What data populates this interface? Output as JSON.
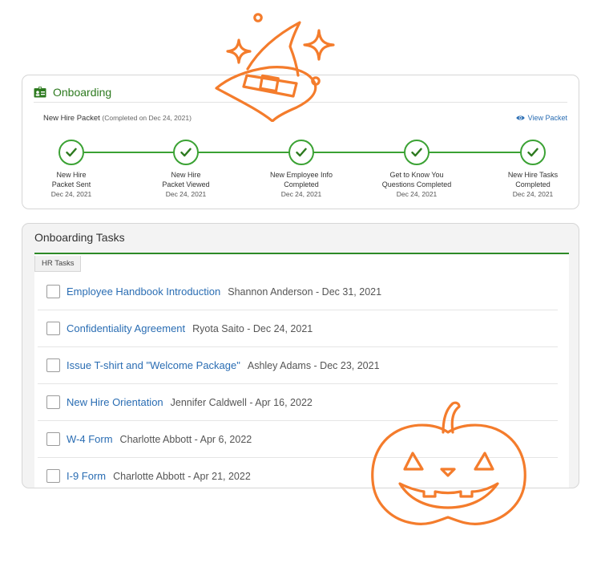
{
  "onboarding": {
    "title": "Onboarding",
    "packet_label": "New Hire Packet",
    "packet_status": "(Completed on Dec 24, 2021)",
    "view_packet": "View Packet",
    "steps": [
      {
        "line1": "New Hire",
        "line2": "Packet Sent",
        "date": "Dec 24, 2021"
      },
      {
        "line1": "New Hire",
        "line2": "Packet Viewed",
        "date": "Dec 24, 2021"
      },
      {
        "line1": "New Employee Info",
        "line2": "Completed",
        "date": "Dec 24, 2021"
      },
      {
        "line1": "Get to Know You",
        "line2": "Questions Completed",
        "date": "Dec 24, 2021"
      },
      {
        "line1": "New Hire Tasks",
        "line2": "Completed",
        "date": "Dec 24, 2021"
      }
    ]
  },
  "tasks": {
    "title": "Onboarding Tasks",
    "tab_label": "HR Tasks",
    "items": [
      {
        "name": "Employee Handbook Introduction",
        "meta": "Shannon Anderson - Dec 31, 2021"
      },
      {
        "name": "Confidentiality Agreement",
        "meta": "Ryota Saito - Dec 24, 2021"
      },
      {
        "name": "Issue T-shirt and \"Welcome Package\"",
        "meta": "Ashley Adams - Dec 23, 2021"
      },
      {
        "name": "New Hire Orientation",
        "meta": "Jennifer Caldwell - Apr 16, 2022"
      },
      {
        "name": "W-4 Form",
        "meta": "Charlotte Abbott - Apr 6, 2022"
      },
      {
        "name": "I-9 Form",
        "meta": "Charlotte Abbott - Apr 21, 2022"
      }
    ]
  },
  "colors": {
    "brand_green": "#2d7a1f",
    "progress_green": "#3ba234",
    "link_blue": "#2a6db3",
    "decoration_orange": "#f47c2c"
  },
  "icons": {
    "header": "id-card-icon",
    "view": "eye-icon",
    "step": "checkmark-icon",
    "decoration_1": "witch-hat-icon",
    "decoration_2": "jack-o-lantern-icon"
  }
}
